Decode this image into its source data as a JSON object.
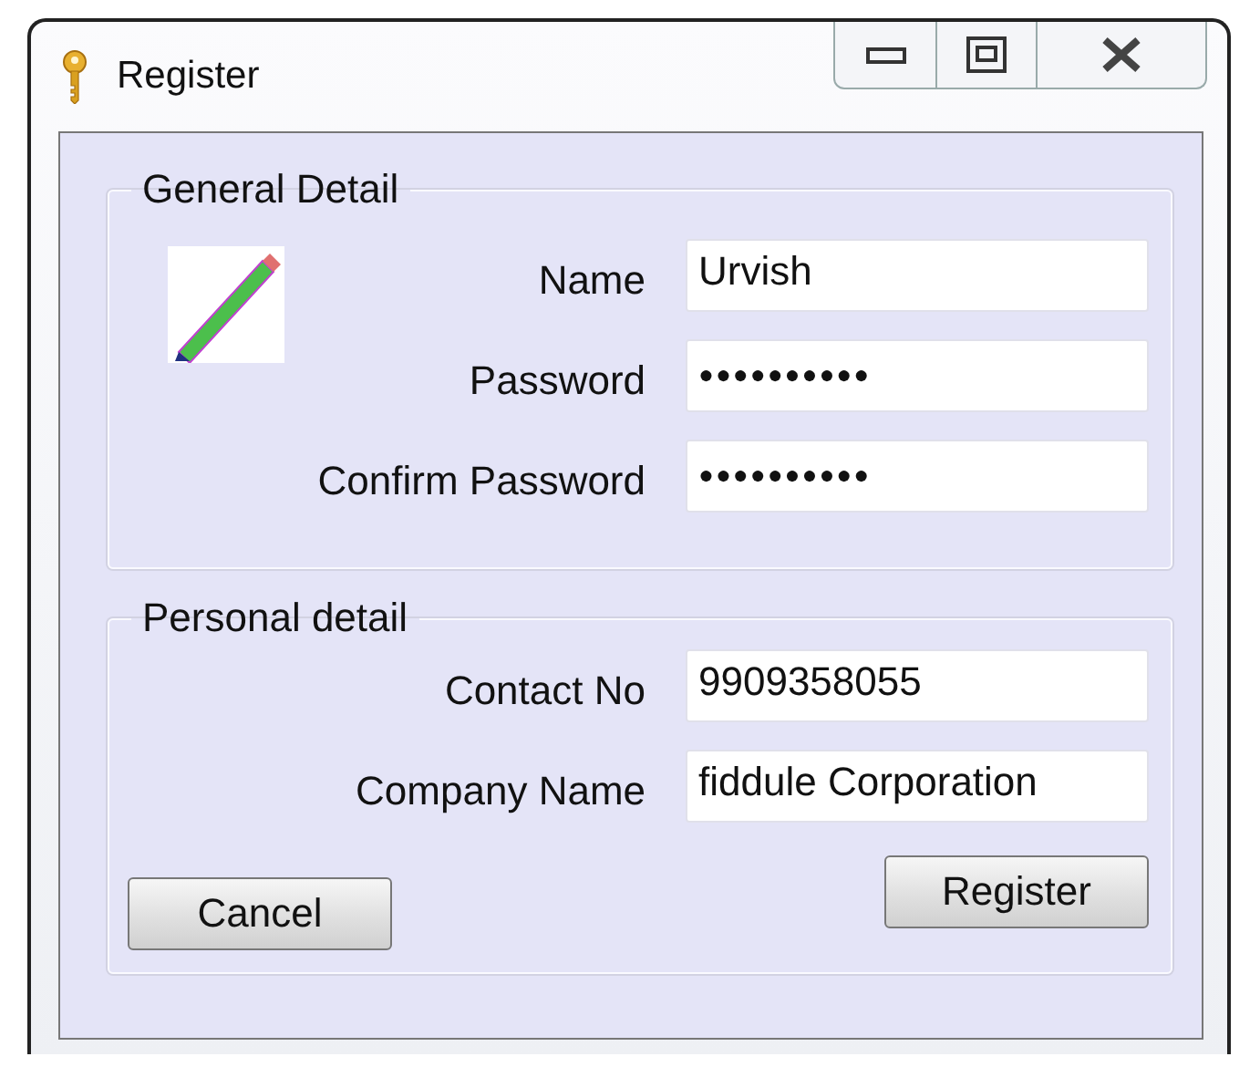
{
  "window": {
    "title": "Register"
  },
  "groups": [
    {
      "title": "General Detail",
      "kind": "with-picture",
      "fields": [
        {
          "label": "Name",
          "value": "Urvish",
          "kind": "text"
        },
        {
          "label": "Password",
          "value": "●●●●●●●●●●",
          "kind": "password"
        },
        {
          "label": "Confirm Password",
          "value": "●●●●●●●●●●",
          "kind": "password"
        }
      ]
    },
    {
      "title": "Personal detail",
      "kind": "plain",
      "fields": [
        {
          "label": "Contact No",
          "value": "9909358055",
          "kind": "text"
        },
        {
          "label": "Company Name",
          "value": "fiddule Corporation",
          "kind": "text"
        }
      ]
    }
  ],
  "buttons": [
    "Cancel",
    "Register"
  ]
}
